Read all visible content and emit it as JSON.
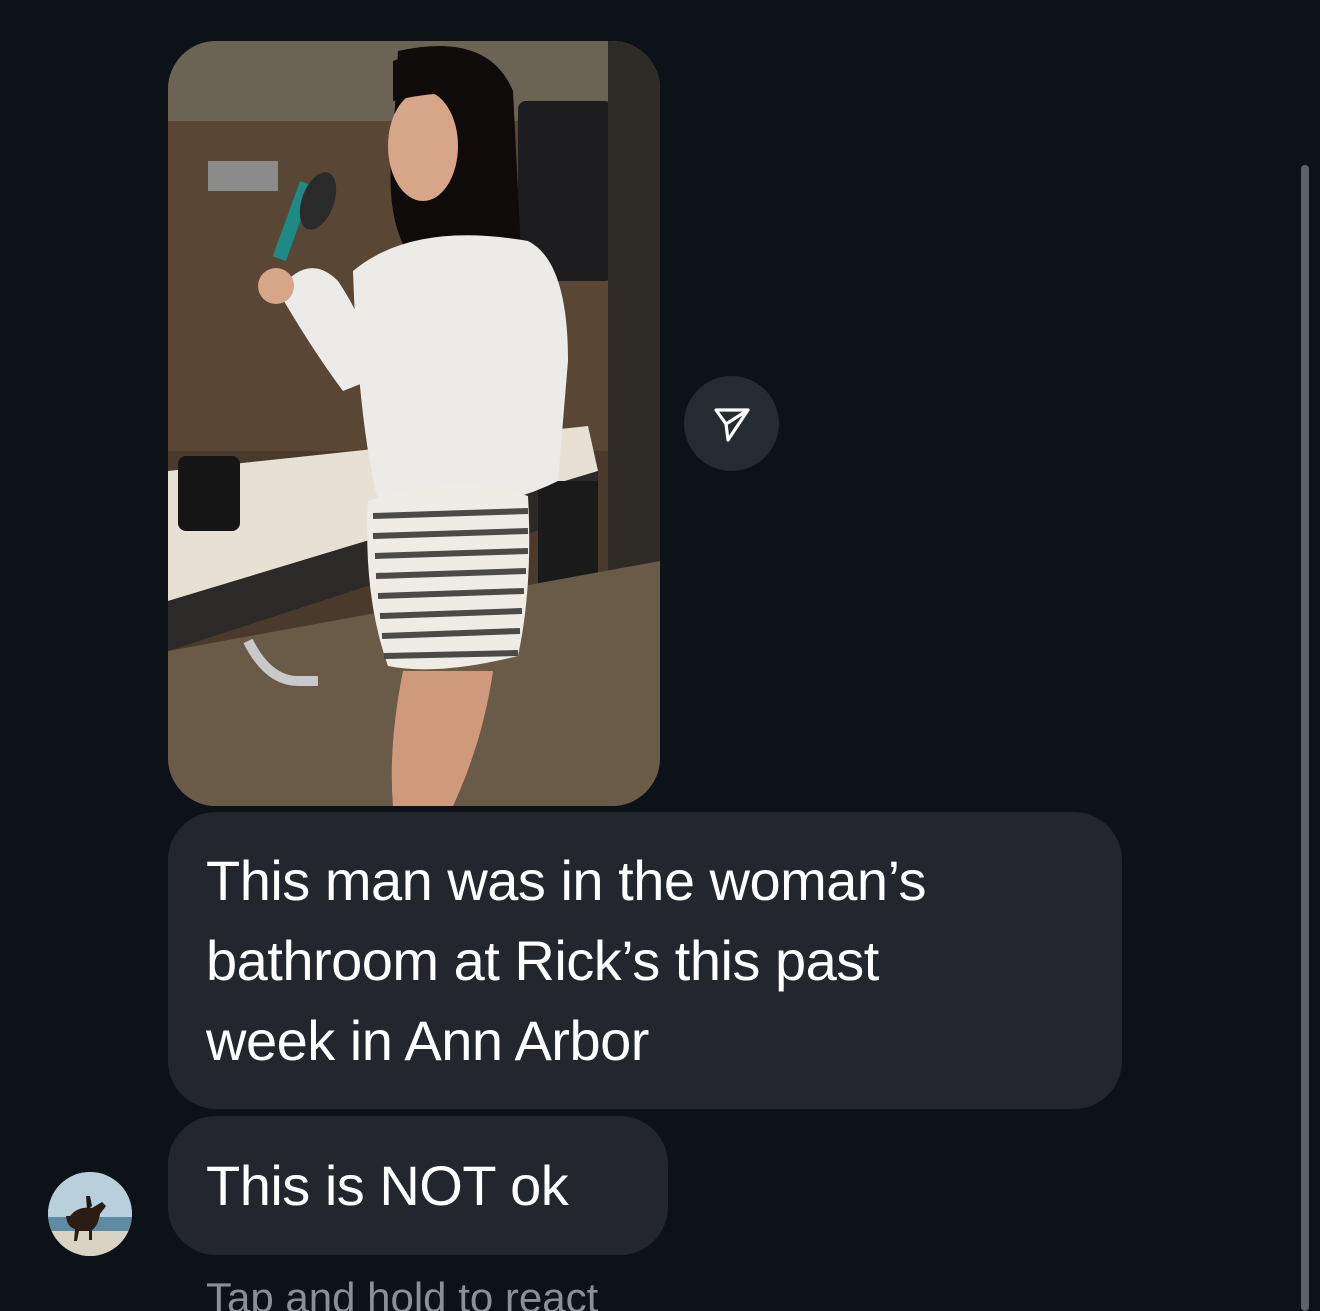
{
  "thread": {
    "messages": [
      {
        "type": "photo",
        "icon": "share-icon"
      },
      {
        "type": "text",
        "lines": [
          "This man was in the woman’s",
          "bathroom at Rick’s this past",
          "week in Ann Arbor"
        ]
      },
      {
        "type": "text",
        "text": "This is NOT ok"
      }
    ],
    "react_hint": "Tap and hold to react"
  },
  "colors": {
    "background": "#0d1118",
    "bubble": "#23262d",
    "text": "#ffffff",
    "hint_text": "#8a8f98",
    "share_button": "#262a31"
  }
}
